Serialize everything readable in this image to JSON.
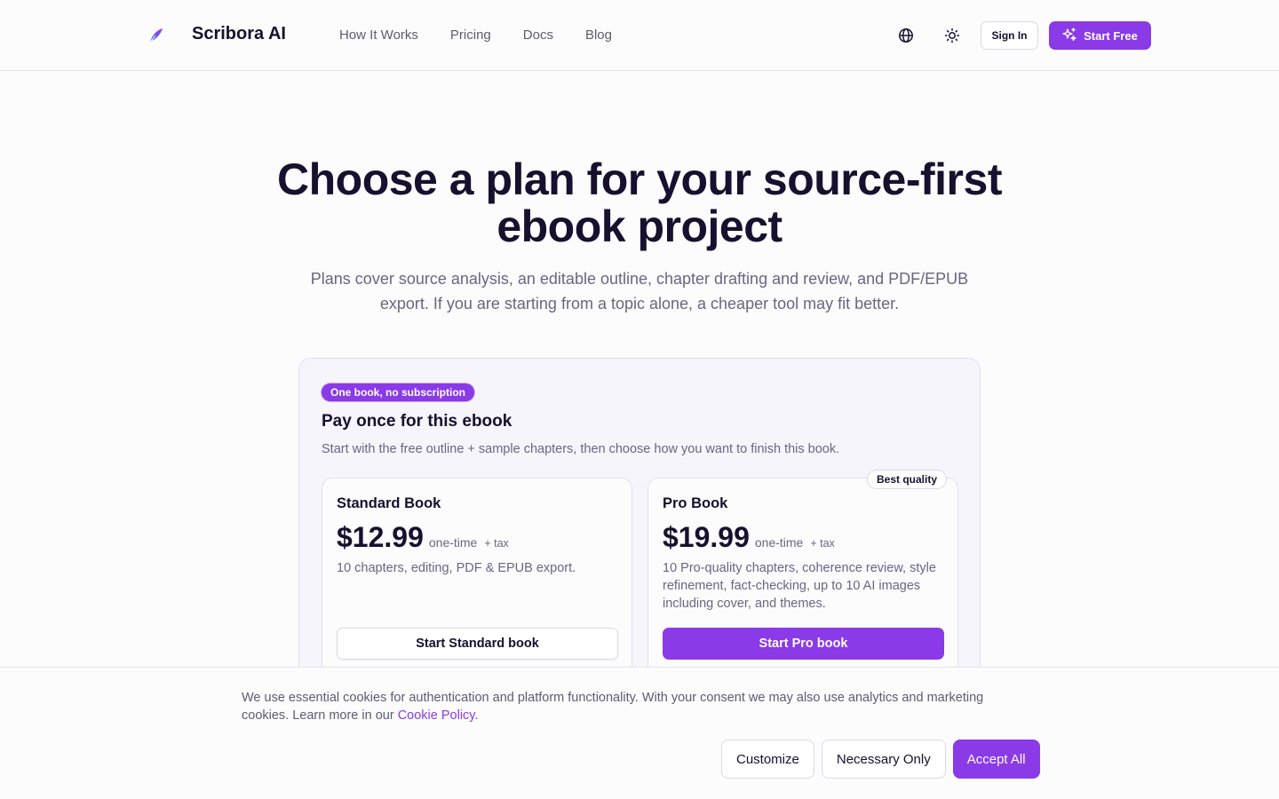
{
  "header": {
    "brand": "Scribora AI",
    "nav": [
      "How It Works",
      "Pricing",
      "Docs",
      "Blog"
    ],
    "sign_in": "Sign In",
    "start_free": "Start Free"
  },
  "hero": {
    "title_line1": "Choose a plan for your source-first",
    "title_line2": "ebook project",
    "subtitle_line1": "Plans cover source analysis, an editable outline, chapter drafting and review, and PDF/EPUB",
    "subtitle_line2": "export. If you are starting from a topic alone, a cheaper tool may fit better."
  },
  "plan": {
    "badge": "One book, no subscription",
    "title": "Pay once for this ebook",
    "description": "Start with the free outline + sample chapters, then choose how you want to finish this book.",
    "cards": [
      {
        "name": "Standard Book",
        "price": "$12.99",
        "term": "one-time",
        "tax": "+ tax",
        "description": "10 chapters, editing, PDF & EPUB export.",
        "cta": "Start Standard book"
      },
      {
        "name": "Pro Book",
        "price": "$19.99",
        "term": "one-time",
        "tax": "+ tax",
        "description": "10 Pro-quality chapters, coherence review, style refinement, fact-checking, up to 10 AI images including cover, and themes.",
        "cta": "Start Pro book",
        "badge": "Best quality"
      }
    ]
  },
  "cookie": {
    "text_line1": "We use essential cookies for authentication and platform functionality. With your consent we may also use analytics and marketing",
    "text_line2": "cookies. Learn more in our ",
    "link": "Cookie Policy",
    "period": ".",
    "customize": "Customize",
    "necessary": "Necessary Only",
    "accept": "Accept All"
  },
  "colors": {
    "accent": "#8a3ae6",
    "text": "#17102e",
    "muted": "#6a6580"
  }
}
